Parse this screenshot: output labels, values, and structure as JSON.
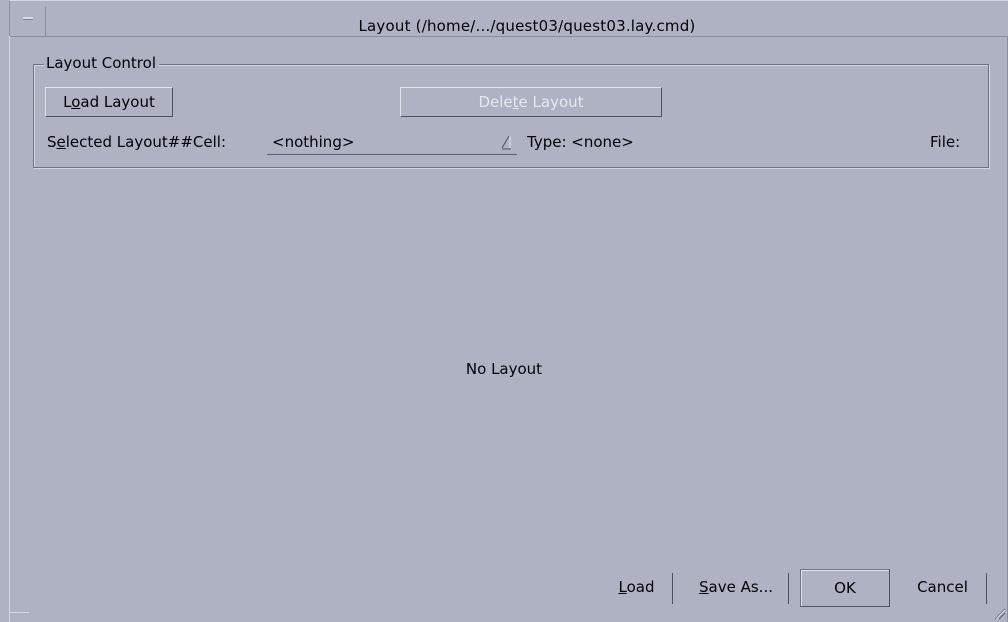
{
  "window": {
    "title": "Layout (/home/.../quest03/quest03.lay.cmd)"
  },
  "layout_control": {
    "group_label": "Layout Control",
    "load_layout_button": {
      "pre": "L",
      "key": "o",
      "post": "ad Layout"
    },
    "delete_layout_button": {
      "pre": "Dele",
      "key": "t",
      "post": "e Layout",
      "enabled": false
    },
    "selected_label": {
      "pre": "S",
      "key": "e",
      "post": "lected Layout##Cell:"
    },
    "selected_value": "<nothing>",
    "type_label": "Type: <none>",
    "file_label": "File:"
  },
  "main": {
    "empty_message": "No Layout"
  },
  "footer": {
    "load_button": {
      "key": "L",
      "post": "oad"
    },
    "save_as_button": {
      "key": "S",
      "post": "ave As..."
    },
    "ok_button": "OK",
    "cancel_button": "Cancel"
  },
  "colors": {
    "background": "#aeb2c3",
    "disabled_text": "#e6e8ef"
  },
  "icons": {
    "window_menu": "window-menu-icon",
    "combo_arrow": "combo-arrow-icon",
    "resize_grip": "resize-grip-icon"
  }
}
